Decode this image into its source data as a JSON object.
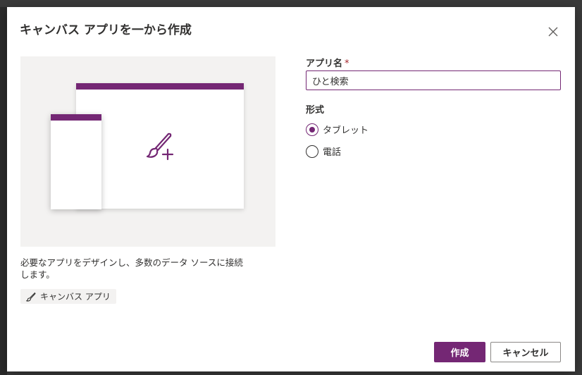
{
  "dialog": {
    "title": "キャンバス アプリを一から作成",
    "close_icon": "close-icon",
    "illustration": {
      "accent_color": "#742774",
      "icon": "paintbrush-add-icon"
    },
    "description": "必要なアプリをデザインし、多数のデータ ソースに接続します。",
    "tag": {
      "icon": "paintbrush-icon",
      "label": "キャンバス アプリ"
    },
    "form": {
      "app_name_label": "アプリ名",
      "required_marker": "*",
      "app_name_value": "ひと検索",
      "format_label": "形式",
      "format_options": [
        {
          "label": "タブレット",
          "selected": true
        },
        {
          "label": "電話",
          "selected": false
        }
      ]
    },
    "buttons": {
      "create": "作成",
      "cancel": "キャンセル"
    }
  },
  "colors": {
    "accent": "#742774",
    "required": "#a4262c"
  }
}
